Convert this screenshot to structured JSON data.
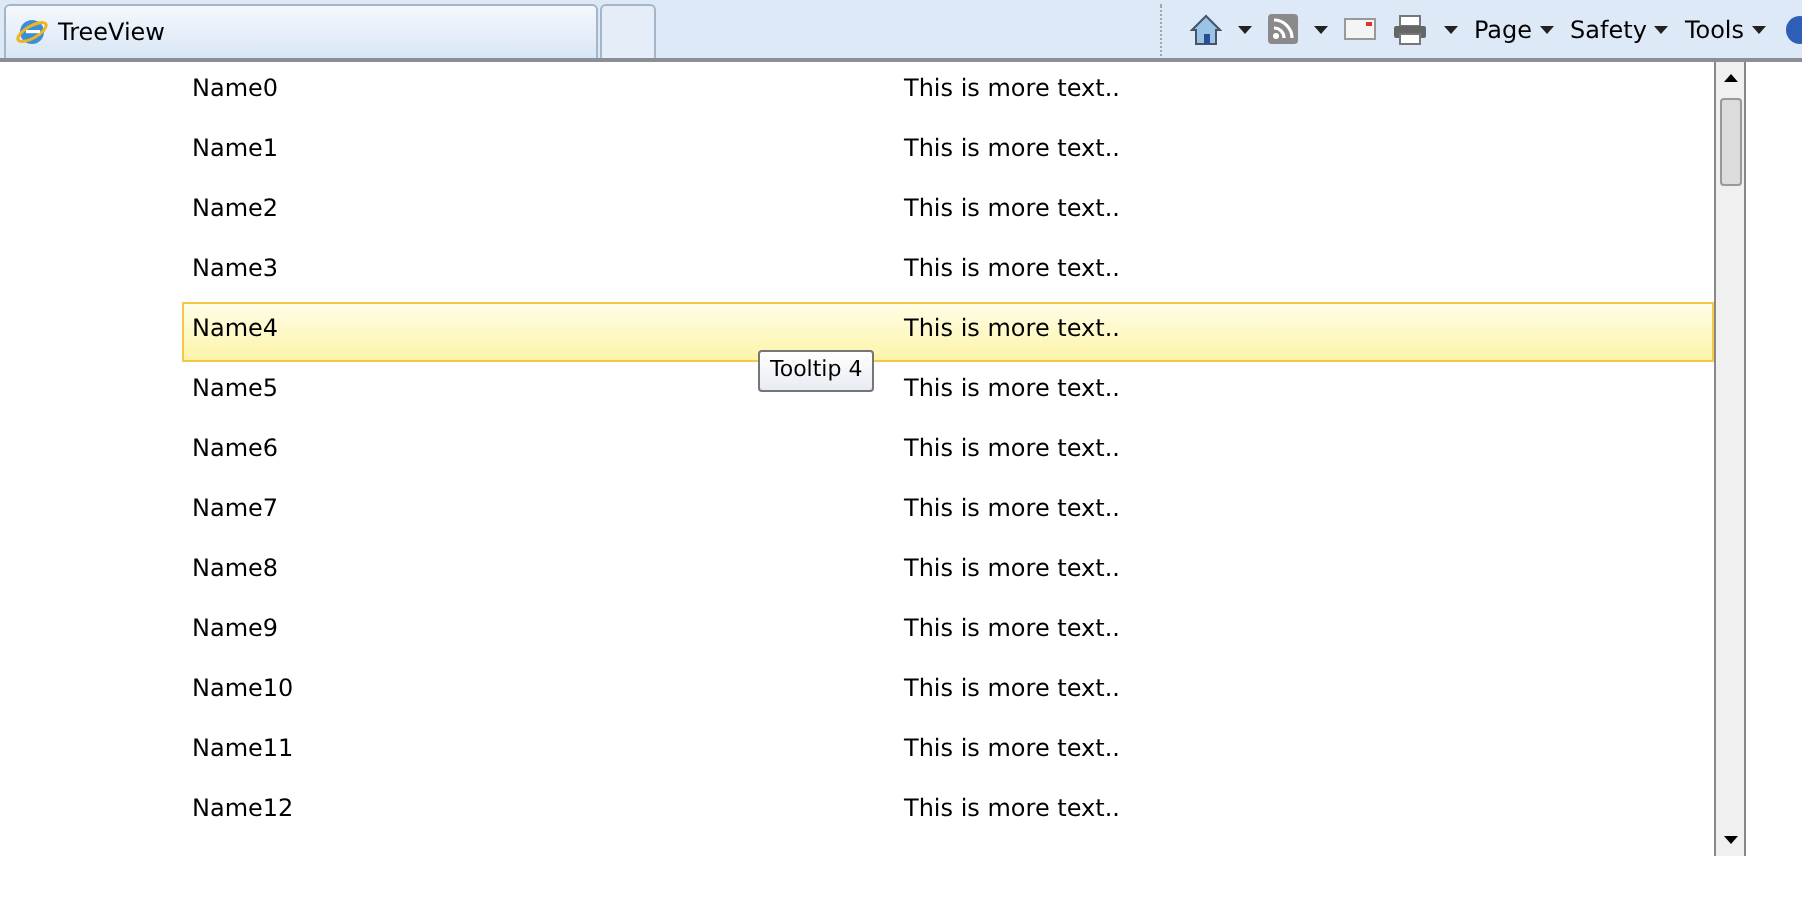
{
  "tabs": [
    {
      "label": "TreeView",
      "selected": true
    },
    {
      "selected": false
    }
  ],
  "command_bar": {
    "menus": [
      "Page",
      "Safety",
      "Tools"
    ]
  },
  "list": {
    "rows": [
      {
        "name": "Name0",
        "text": "This is more text..",
        "selected": false
      },
      {
        "name": "Name1",
        "text": "This is more text..",
        "selected": false
      },
      {
        "name": "Name2",
        "text": "This is more text..",
        "selected": false
      },
      {
        "name": "Name3",
        "text": "This is more text..",
        "selected": false
      },
      {
        "name": "Name4",
        "text": "This is more text..",
        "selected": true
      },
      {
        "name": "Name5",
        "text": "This is more text..",
        "selected": false
      },
      {
        "name": "Name6",
        "text": "This is more text..",
        "selected": false
      },
      {
        "name": "Name7",
        "text": "This is more text..",
        "selected": false
      },
      {
        "name": "Name8",
        "text": "This is more text..",
        "selected": false
      },
      {
        "name": "Name9",
        "text": "This is more text..",
        "selected": false
      },
      {
        "name": "Name10",
        "text": "This is more text..",
        "selected": false
      },
      {
        "name": "Name11",
        "text": "This is more text..",
        "selected": false
      },
      {
        "name": "Name12",
        "text": "This is more text..",
        "selected": false
      }
    ],
    "tooltip": "Tooltip 4"
  }
}
